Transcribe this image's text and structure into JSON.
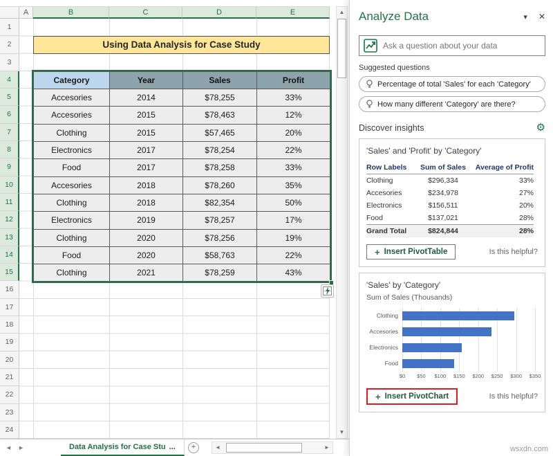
{
  "icons": {
    "caret_down": "▾",
    "close": "✕",
    "nav_left": "◄",
    "nav_right": "►",
    "scroll_up": "▲",
    "scroll_down": "▼",
    "scroll_left": "◄",
    "scroll_right": "►",
    "gear": "⚙",
    "plus": "+"
  },
  "colors": {
    "excel_green": "#217346",
    "selection_green": "#1E7145",
    "title_fill": "#FFE699",
    "table_header_category_fill": "#BDD7EE",
    "table_header_fill": "#8EA4AD",
    "table_body_fill": "#EDEDED",
    "chart_bar_blue": "#4472C4",
    "highlight_red": "#E11B22"
  },
  "excel": {
    "col_headers": [
      "A",
      "B",
      "C",
      "D",
      "E"
    ],
    "row_numbers": [
      "1",
      "2",
      "3",
      "4",
      "5",
      "6",
      "7",
      "8",
      "9",
      "10",
      "11",
      "12",
      "13",
      "14",
      "15",
      "16",
      "17",
      "18",
      "19",
      "20",
      "21",
      "22",
      "23",
      "24"
    ],
    "title": "Using Data Analysis for Case Study",
    "table": {
      "headers": [
        "Category",
        "Year",
        "Sales",
        "Profit"
      ],
      "rows": [
        [
          "Accesories",
          "2014",
          "$78,255",
          "33%"
        ],
        [
          "Accesories",
          "2015",
          "$78,463",
          "12%"
        ],
        [
          "Clothing",
          "2015",
          "$57,465",
          "20%"
        ],
        [
          "Electronics",
          "2017",
          "$78,254",
          "22%"
        ],
        [
          "Food",
          "2017",
          "$78,258",
          "33%"
        ],
        [
          "Accesories",
          "2018",
          "$78,260",
          "35%"
        ],
        [
          "Clothing",
          "2018",
          "$82,354",
          "50%"
        ],
        [
          "Electronics",
          "2019",
          "$78,257",
          "17%"
        ],
        [
          "Clothing",
          "2020",
          "$78,256",
          "19%"
        ],
        [
          "Food",
          "2020",
          "$58,763",
          "22%"
        ],
        [
          "Clothing",
          "2021",
          "$78,259",
          "43%"
        ]
      ]
    },
    "sheet_tab": "Data Analysis for Case Stu",
    "sheet_tab_more": "...",
    "new_sheet": "+"
  },
  "pane": {
    "title": "Analyze Data",
    "search_placeholder": "Ask a question about your data",
    "suggested_label": "Suggested questions",
    "suggestions": [
      "Percentage of total 'Sales' for each 'Category'",
      "How many different 'Category' are there?"
    ],
    "insights_label": "Discover insights",
    "card1": {
      "title": "'Sales' and 'Profit' by 'Category'",
      "table": {
        "headers": [
          "Row Labels",
          "Sum of Sales",
          "Average of Profit"
        ],
        "rows": [
          [
            "Clothing",
            "$296,334",
            "33%"
          ],
          [
            "Accesories",
            "$234,978",
            "27%"
          ],
          [
            "Electronics",
            "$156,511",
            "20%"
          ],
          [
            "Food",
            "$137,021",
            "28%"
          ]
        ],
        "total": [
          "Grand Total",
          "$824,844",
          "28%"
        ]
      },
      "insert_button": "Insert PivotTable",
      "helpful": "Is this helpful?"
    },
    "card2": {
      "title": "'Sales' by 'Category'",
      "subtitle": "Sum of Sales (Thousands)",
      "insert_button": "Insert PivotChart",
      "helpful": "Is this helpful?"
    }
  },
  "chart_data": {
    "type": "bar",
    "orientation": "horizontal",
    "title": "'Sales' by 'Category'",
    "subtitle": "Sum of Sales (Thousands)",
    "categories": [
      "Clothing",
      "Accesories",
      "Electronics",
      "Food"
    ],
    "values": [
      296,
      235,
      157,
      137
    ],
    "unit": "thousands of dollars",
    "xlim": [
      0,
      350
    ],
    "x_ticks": [
      "$0",
      "$50",
      "$100",
      "$150",
      "$200",
      "$250",
      "$300",
      "$350"
    ],
    "bar_color": "#4472C4",
    "grid": true,
    "legend": "none"
  },
  "watermark": "wsxdn.com"
}
